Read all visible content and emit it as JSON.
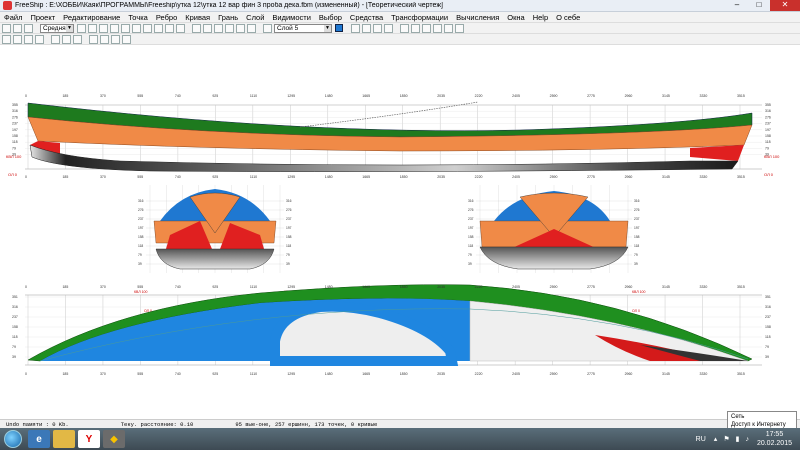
{
  "window": {
    "title": "FreeShip : E:\\ХОББИ\\Каяк\\ПРОГРАММЫ\\Freeship\\утка 12\\утка 12 вар фин 3 проба дека.fbm (измененный) - [Теоретический чертеж]",
    "minimize": "–",
    "maximize": "□",
    "close": "✕"
  },
  "menu": [
    "Файл",
    "Проект",
    "Редактирование",
    "Точка",
    "Ребро",
    "Кривая",
    "Грань",
    "Слой",
    "Видимости",
    "Выбор",
    "Средства",
    "Трансформации",
    "Вычисления",
    "Окна",
    "Help",
    "О себе"
  ],
  "toolbar": {
    "precision_value": "Средняя",
    "layer_value": "Слой 5",
    "layer_color": "#1f78d1"
  },
  "drawing": {
    "stations": [
      "0",
      "185",
      "370",
      "555",
      "740",
      "925",
      "1110",
      "1295",
      "1480",
      "1665",
      "1850",
      "2035",
      "2220",
      "2405",
      "2590",
      "2775",
      "2960",
      "3145",
      "3330",
      "3515"
    ],
    "profile_height_labels": [
      "355",
      "316",
      "276",
      "237",
      "197",
      "158",
      "118",
      "79",
      "39"
    ],
    "profile_label_bottom": "ОЛ 0",
    "profile_label_dwl": "КВЛ 100",
    "section_water_labels": [
      "316",
      "276",
      "237",
      "197",
      "158",
      "118",
      "79",
      "39"
    ],
    "plan_labels": [
      "351",
      "316",
      "237",
      "158",
      "118",
      "79",
      "39"
    ],
    "colors": {
      "deck": "#1e7a1e",
      "topside": "#f08a47",
      "waterline": "#e02020",
      "bottom": "#3e3e3e",
      "plan_deck": "#1f8f1f",
      "plan_blue": "#1f86e0"
    }
  },
  "status": {
    "undo": "Undo памяти : 0 Kb.",
    "distance": "Теку. расстояние: 0.10",
    "counts": "95 вые-оне, 257 ершинн, 173 точек, 0 кривые"
  },
  "taskbar": {
    "lang": "RU",
    "time": "17:55",
    "date": "20.02.2015"
  },
  "tooltip": {
    "line1": "Сеть",
    "line2": "Доступ к Интернету"
  }
}
